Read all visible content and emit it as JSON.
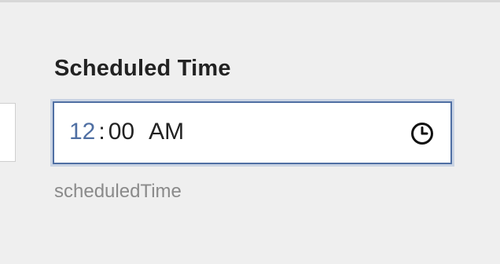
{
  "field": {
    "label": "Scheduled Time",
    "helper": "scheduledTime",
    "value": {
      "hour": "12",
      "separator": ":",
      "minute": "00",
      "period": "AM"
    },
    "icon": "clock-icon"
  }
}
